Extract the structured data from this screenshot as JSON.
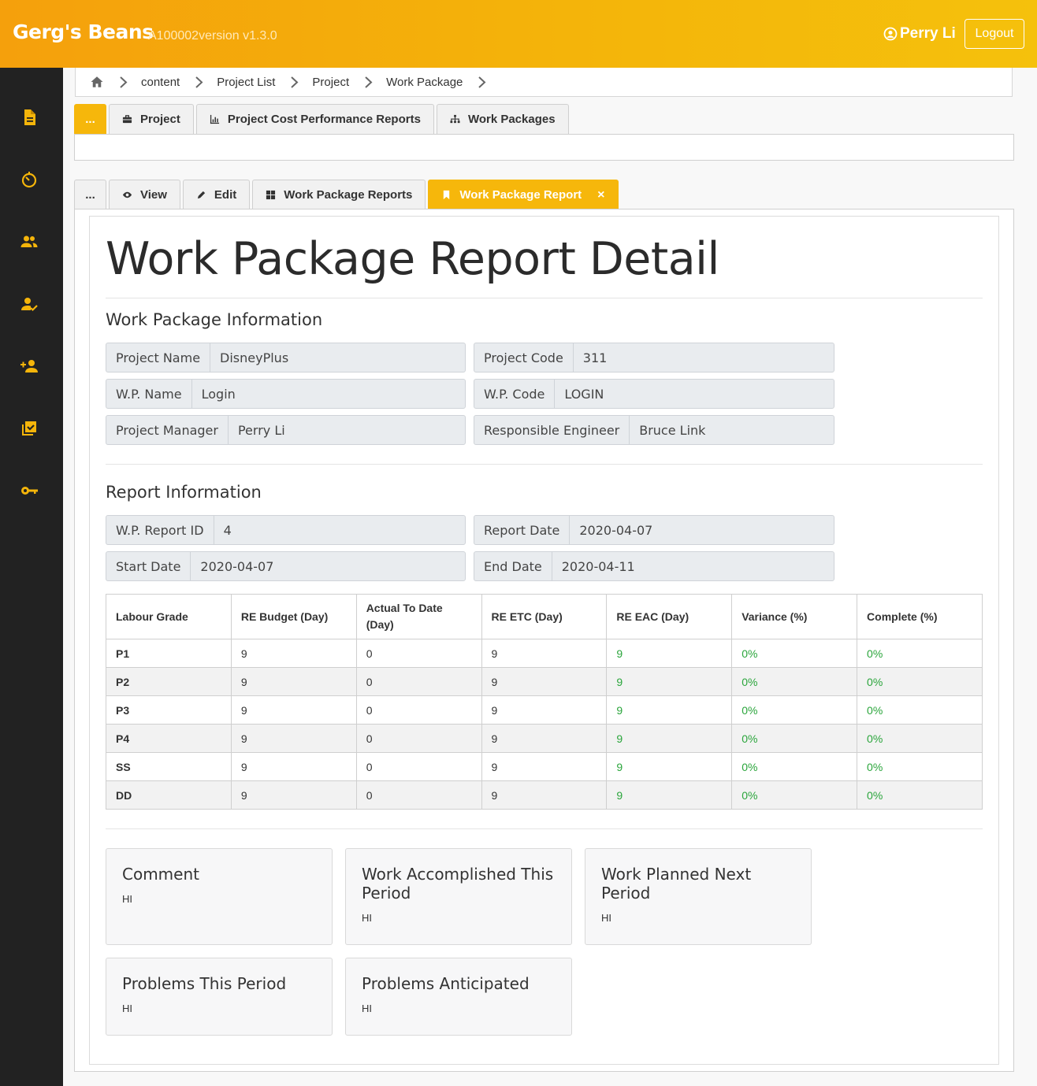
{
  "header": {
    "brand": "Gerg's Beans",
    "version": "A100002version v1.3.0",
    "user_name": "Perry Li",
    "logout_label": "Logout"
  },
  "sidebar": {
    "icons": [
      "document-icon",
      "timer-icon",
      "group-icon",
      "user-check-icon",
      "user-add-icon",
      "checkbox-icon",
      "key-icon"
    ]
  },
  "breadcrumb": [
    "content",
    "Project List",
    "Project",
    "Work Package"
  ],
  "top_tabs": [
    {
      "label": "...",
      "icon": "",
      "active": true
    },
    {
      "label": "Project",
      "icon": "briefcase-icon",
      "active": false
    },
    {
      "label": "Project Cost Performance Reports",
      "icon": "chart-icon",
      "active": false
    },
    {
      "label": "Work Packages",
      "icon": "sitemap-icon",
      "active": false
    }
  ],
  "sub_tabs": [
    {
      "label": "...",
      "icon": "",
      "active": false
    },
    {
      "label": "View",
      "icon": "eye-icon",
      "active": false
    },
    {
      "label": "Edit",
      "icon": "pencil-icon",
      "active": false
    },
    {
      "label": "Work Package Reports",
      "icon": "grid-icon",
      "active": false
    },
    {
      "label": "Work Package Report",
      "icon": "bookmark-icon",
      "active": true,
      "close": "×"
    }
  ],
  "page_title": "Work Package Report Detail",
  "wp_info": {
    "title": "Work Package Information",
    "project_name_label": "Project Name",
    "project_name": "DisneyPlus",
    "project_code_label": "Project Code",
    "project_code": "311",
    "wp_name_label": "W.P. Name",
    "wp_name": "Login",
    "wp_code_label": "W.P. Code",
    "wp_code": "LOGIN",
    "manager_label": "Project Manager",
    "manager": "Perry Li",
    "engineer_label": "Responsible Engineer",
    "engineer": "Bruce Link"
  },
  "report_info": {
    "title": "Report Information",
    "report_id_label": "W.P. Report ID",
    "report_id": "4",
    "report_date_label": "Report Date",
    "report_date": "2020-04-07",
    "start_date_label": "Start Date",
    "start_date": "2020-04-07",
    "end_date_label": "End Date",
    "end_date": "2020-04-11"
  },
  "table": {
    "headers": [
      "Labour Grade",
      "RE Budget (Day)",
      "Actual To Date (Day)",
      "RE ETC (Day)",
      "RE EAC (Day)",
      "Variance (%)",
      "Complete (%)"
    ],
    "rows": [
      [
        "P1",
        "9",
        "0",
        "9",
        "9",
        "0%",
        "0%"
      ],
      [
        "P2",
        "9",
        "0",
        "9",
        "9",
        "0%",
        "0%"
      ],
      [
        "P3",
        "9",
        "0",
        "9",
        "9",
        "0%",
        "0%"
      ],
      [
        "P4",
        "9",
        "0",
        "9",
        "9",
        "0%",
        "0%"
      ],
      [
        "SS",
        "9",
        "0",
        "9",
        "9",
        "0%",
        "0%"
      ],
      [
        "DD",
        "9",
        "0",
        "9",
        "9",
        "0%",
        "0%"
      ]
    ]
  },
  "cards": {
    "comment": {
      "title": "Comment",
      "body": "HI"
    },
    "accomplished": {
      "title": "Work Accomplished This Period",
      "body": "HI"
    },
    "planned": {
      "title": "Work Planned Next Period",
      "body": "HI"
    },
    "problems": {
      "title": "Problems This Period",
      "body": "HI"
    },
    "anticipated": {
      "title": "Problems Anticipated",
      "body": "HI"
    }
  },
  "colors": {
    "accent": "#f6b70b",
    "sidebar": "#222222",
    "positive": "#2aa53b"
  }
}
